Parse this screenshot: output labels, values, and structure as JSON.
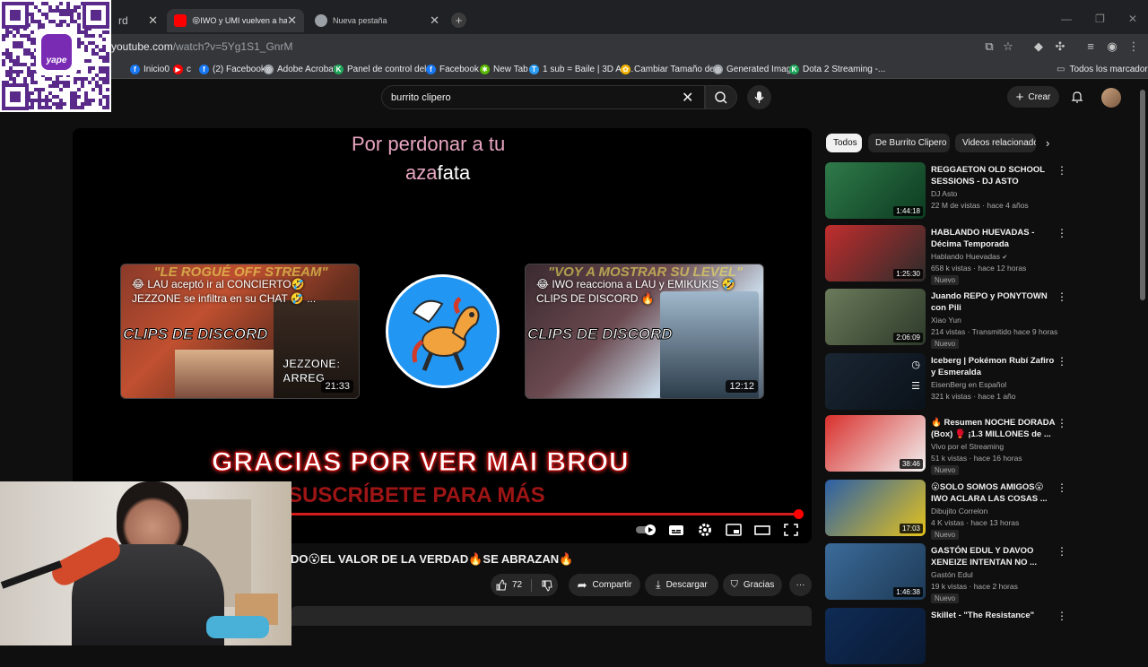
{
  "browser": {
    "tabs": [
      {
        "title": "rd",
        "active": false
      },
      {
        "title": "😝IWO y UMI vuelven a hacer I",
        "active": true
      },
      {
        "title": "Nueva pestaña",
        "active": false
      }
    ],
    "new_tab_symbol": "+",
    "url_host": "youtube.com",
    "url_path": "/watch?v=5Yg1S1_GnrM",
    "bookmarks": [
      {
        "label": "Inicio0",
        "color": "#1877f2",
        "glyph": "f"
      },
      {
        "label": "c",
        "color": "#ff0000",
        "glyph": "▶"
      },
      {
        "label": "(2) Facebook",
        "color": "#1877f2",
        "glyph": "f"
      },
      {
        "label": "Adobe Acrobat",
        "color": "#9aa0a6",
        "glyph": "◎"
      },
      {
        "label": "Panel de control del...",
        "color": "#1fa55a",
        "glyph": "K"
      },
      {
        "label": "Facebook",
        "color": "#1877f2",
        "glyph": "f"
      },
      {
        "label": "New Tab",
        "color": "#59b800",
        "glyph": "✱"
      },
      {
        "label": "1 sub = Baile | 3D Az...",
        "color": "#2a9df4",
        "glyph": "T"
      },
      {
        "label": "Cambiar Tamaño de...",
        "color": "#f4b400",
        "glyph": "✿"
      },
      {
        "label": "Generated Image",
        "color": "#9aa0a6",
        "glyph": "◎"
      },
      {
        "label": "Dota 2 Streaming -...",
        "color": "#1fa55a",
        "glyph": "K"
      }
    ],
    "all_bookmarks": "Todos los marcadores"
  },
  "qr": {
    "brand": "yape"
  },
  "header": {
    "search_value": "burrito clipero",
    "create_label": "Crear"
  },
  "player": {
    "lyric_line1": "Por perdonar a tu",
    "lyric_line2_a": "aza",
    "lyric_line2_b": "fata",
    "endcard_left": {
      "banner": "\"LE ROGUÉ OFF STREAM\"",
      "title": "😂 LAU aceptó ir al CONCIERTO🤣 JEZZONE se infiltra en su CHAT 🤣 ...",
      "clips": "CLIPS DE DISCORD",
      "overlay": "JEZZONE: ARREG",
      "duration": "21:33"
    },
    "endcard_right": {
      "banner": "\"VOY A MOSTRAR SU LEVEL\"",
      "title": "😂 IWO reacciona a LAU y EMIKUKIS 🤣 CLIPS DE DISCORD 🔥",
      "clips": "CLIPS DE DISCORD",
      "duration": "12:12"
    },
    "thanks_text": "GRACIAS POR VER MAI BROU",
    "subscribe_text": "SUSCRÍBETE PARA MÁS",
    "progress": 0.99
  },
  "video": {
    "title": "DO😮EL VALOR DE LA VERDAD🔥SE ABRAZAN🔥",
    "likes": "72",
    "share_label": "Compartir",
    "download_label": "Descargar",
    "thanks_label": "Gracias",
    "more_symbol": "···"
  },
  "chips": [
    "Todos",
    "De Burrito Clipero",
    "Videos relacionados"
  ],
  "recommendations": [
    {
      "title": "REGGAETON OLD SCHOOL SESSIONS - DJ ASTO",
      "channel": "DJ Asto",
      "meta": "22 M de vistas · hace 4 años",
      "duration": "1:44:18",
      "badge": "",
      "verified": false,
      "c1": "#2f7a4a",
      "c2": "#0c3b20"
    },
    {
      "title": "HABLANDO HUEVADAS - Décima Temporada [RICARDO...",
      "channel": "Hablando Huevadas",
      "meta": "658 k vistas · hace 12 horas",
      "duration": "1:25:30",
      "badge": "Nuevo",
      "verified": true,
      "c1": "#c22d2d",
      "c2": "#2b2b2b"
    },
    {
      "title": "Juando REPO y PONYTOWN con Pili",
      "channel": "Xiao Yun",
      "meta": "214 vistas · Transmitido hace 9 horas",
      "duration": "2:06:09",
      "badge": "Nuevo",
      "verified": false,
      "c1": "#6b7a5a",
      "c2": "#2d3a2a"
    },
    {
      "title": "Iceberg | Pokémon Rubí Zafiro y Esmeralda",
      "channel": "EisenBerg en Español",
      "meta": "321 k vistas · hace 1 año",
      "duration": "",
      "badge": "",
      "verified": false,
      "c1": "#1a2633",
      "c2": "#0a1119"
    },
    {
      "title": "🔥 Resumen NOCHE DORADA (Box) 🥊 ¡1.3 MILLONES de ...",
      "channel": "Vivo por el Streaming",
      "meta": "51 k vistas · hace 16 horas",
      "duration": "38:46",
      "badge": "Nuevo",
      "verified": false,
      "c1": "#d9302c",
      "c2": "#f1f1f1"
    },
    {
      "title": "😮SOLO SOMOS AMIGOS😮 IWO ACLARA LAS COSAS ...",
      "channel": "Dibujito Correlon",
      "meta": "4 K vistas · hace 13 horas",
      "duration": "17:03",
      "badge": "Nuevo",
      "verified": false,
      "c1": "#2a5fa8",
      "c2": "#e5c21c"
    },
    {
      "title": "GASTÓN EDUL Y DAVOO XENEIZE INTENTAN NO ...",
      "channel": "Gastón Edul",
      "meta": "19 k vistas · hace 2 horas",
      "duration": "1:46:38",
      "badge": "Nuevo",
      "verified": false,
      "c1": "#3b6b9a",
      "c2": "#1e3a55"
    },
    {
      "title": "Skillet - \"The Resistance\"",
      "channel": "",
      "meta": "",
      "duration": "",
      "badge": "",
      "verified": false,
      "c1": "#0f2b55",
      "c2": "#0a1a33"
    }
  ]
}
